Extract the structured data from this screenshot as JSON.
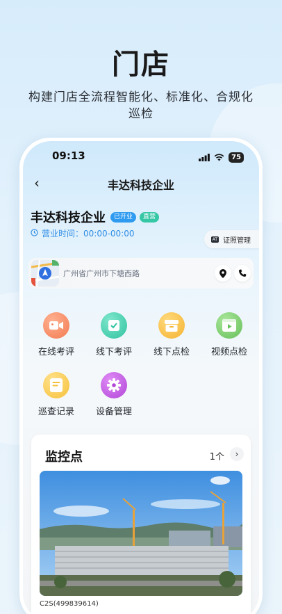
{
  "hero": {
    "title": "门店",
    "subtitle": "构建门店全流程智能化、标准化、合规化巡检"
  },
  "status_bar": {
    "time": "09:13",
    "battery": "75"
  },
  "nav": {
    "back": "‹",
    "title": "丰达科技企业"
  },
  "store": {
    "name": "丰达科技企业",
    "tag_open": "已开业",
    "tag_direct": "直营",
    "hours_label": "营业时间：00:00-00:00",
    "cert_button": "证照管理",
    "cert_icon_text": "AT",
    "address": "广州省广州市下塘西路"
  },
  "functions": [
    {
      "label": "在线考评",
      "icon": "video-camera-icon",
      "color": "#f27b52"
    },
    {
      "label": "线下考评",
      "icon": "check-clipboard-icon",
      "color": "#2fc3a0"
    },
    {
      "label": "线下点检",
      "icon": "box-inspect-icon",
      "color": "#f5b431"
    },
    {
      "label": "视频点检",
      "icon": "video-play-icon",
      "color": "#67bf5a"
    },
    {
      "label": "巡查记录",
      "icon": "document-list-icon",
      "color": "#f6c13a"
    },
    {
      "label": "设备管理",
      "icon": "gear-icon",
      "color": "#b146d8"
    }
  ],
  "monitor": {
    "title": "监控点",
    "count": "1个",
    "arrow": "›",
    "camera_label": "C2S(499839614)"
  }
}
